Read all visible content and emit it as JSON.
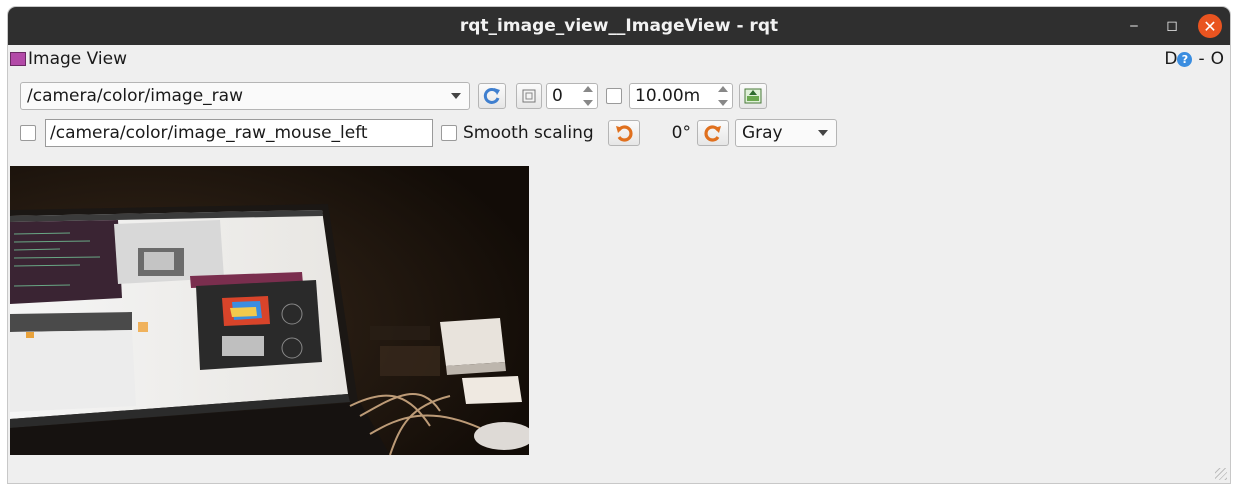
{
  "window": {
    "title": "rqt_image_view__ImageView - rqt",
    "minimize_glyph": "‒",
    "maximize_glyph": "◻",
    "close_glyph": "✕"
  },
  "plugin": {
    "title": "Image View",
    "right_d": "D",
    "right_help": "?",
    "right_minus": "-",
    "right_o": "O"
  },
  "toolbar": {
    "topic": "/camera/color/image_raw",
    "refresh_icon": "refresh-icon",
    "zoom_value": "0",
    "max_range_value": "10.00m",
    "mouse_topic": "/camera/color/image_raw_mouse_left",
    "smooth_scaling_label": "Smooth scaling",
    "rotation_label": "0°",
    "colormap": "Gray"
  },
  "colors": {
    "titlebar": "#2f2f2f",
    "close_button": "#e95420",
    "rotate_icon": "#e0701e",
    "refresh_icon": "#3f7fcf"
  }
}
